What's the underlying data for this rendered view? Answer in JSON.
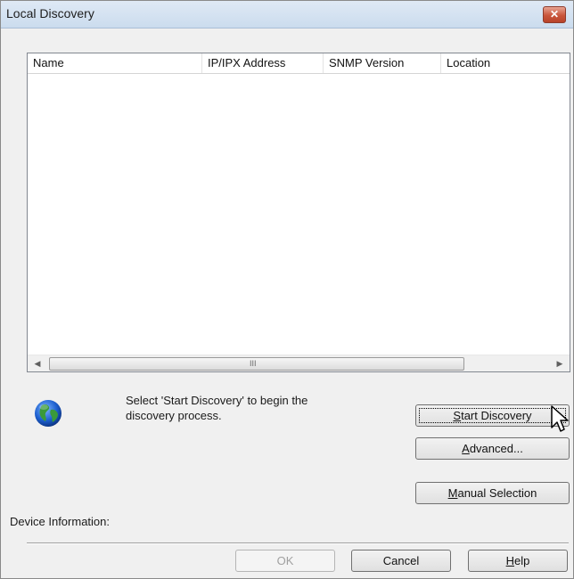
{
  "window": {
    "title": "Local Discovery",
    "close_glyph": "✕"
  },
  "list": {
    "columns": [
      "Name",
      "IP/IPX Address",
      "SNMP Version",
      "Location"
    ],
    "rows": [],
    "scroll_left": "◀",
    "scroll_right": "▶",
    "thumb_grip": "III"
  },
  "status": {
    "icon": "globe-icon",
    "text": "Select 'Start Discovery' to begin the discovery process."
  },
  "buttons": {
    "start_discovery": {
      "prefix": "",
      "mnemonic": "S",
      "rest": "tart Discovery"
    },
    "advanced": {
      "prefix": "",
      "mnemonic": "A",
      "rest": "dvanced..."
    },
    "manual_selection": {
      "prefix": "",
      "mnemonic": "M",
      "rest": "anual Selection"
    },
    "ok": "OK",
    "cancel": "Cancel",
    "help": {
      "prefix": "",
      "mnemonic": "H",
      "rest": "elp"
    }
  },
  "device_info_label": "Device Information:",
  "colors": {
    "titlebar": "#cbdcee",
    "close": "#c9553b",
    "dialog_bg": "#f0f0f0"
  }
}
